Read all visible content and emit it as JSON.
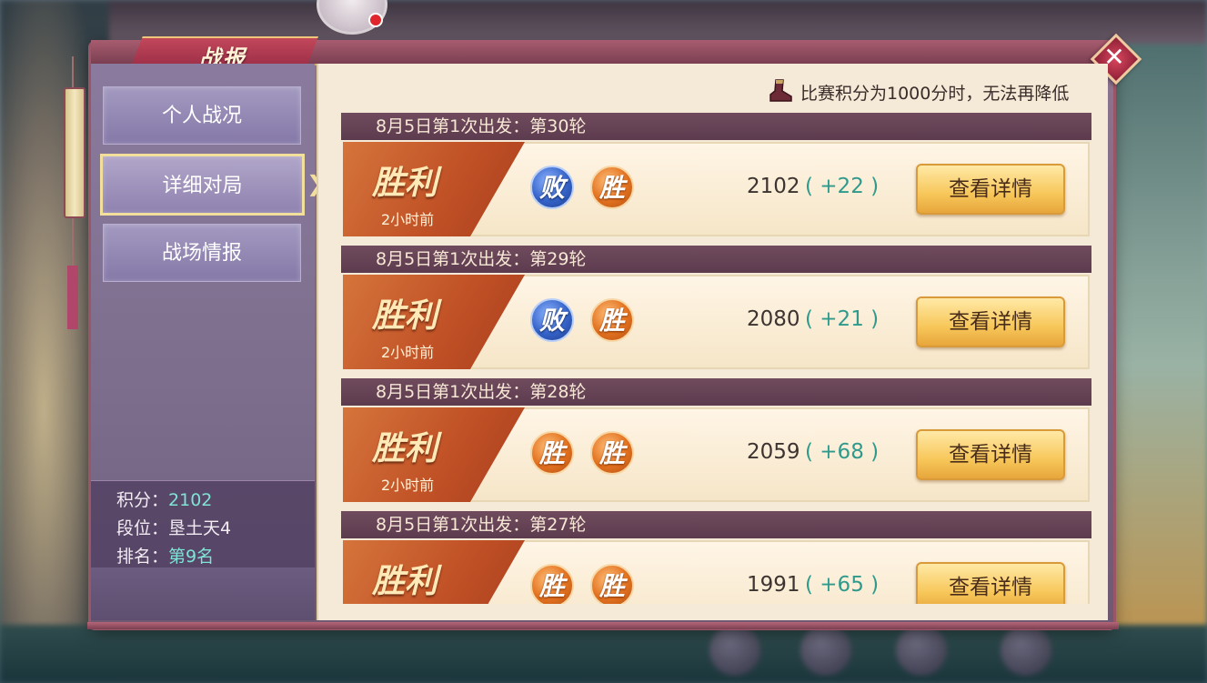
{
  "title": "战报",
  "close_icon": "close-icon",
  "sidebar": {
    "tabs": [
      {
        "label": "个人战况",
        "active": false
      },
      {
        "label": "详细对局",
        "active": true
      },
      {
        "label": "战场情报",
        "active": false
      }
    ],
    "stats": {
      "score_label": "积分：",
      "score_value": "2102",
      "rank_label": "段位：",
      "rank_value": "垦土天4",
      "place_label": "排名：",
      "place_value": "第9名"
    }
  },
  "notice": "比赛积分为1000分时，无法再降低",
  "matches": [
    {
      "header": "8月5日第1次出发：第30轮",
      "result": "胜利",
      "time": "2小时前",
      "medals": [
        {
          "text": "败",
          "type": "lose"
        },
        {
          "text": "胜",
          "type": "win"
        }
      ],
      "score": "2102",
      "delta": "( +22 )",
      "button": "查看详情"
    },
    {
      "header": "8月5日第1次出发：第29轮",
      "result": "胜利",
      "time": "2小时前",
      "medals": [
        {
          "text": "败",
          "type": "lose"
        },
        {
          "text": "胜",
          "type": "win"
        }
      ],
      "score": "2080",
      "delta": "( +21 )",
      "button": "查看详情"
    },
    {
      "header": "8月5日第1次出发：第28轮",
      "result": "胜利",
      "time": "2小时前",
      "medals": [
        {
          "text": "胜",
          "type": "win"
        },
        {
          "text": "胜",
          "type": "win"
        }
      ],
      "score": "2059",
      "delta": "( +68 )",
      "button": "查看详情"
    },
    {
      "header": "8月5日第1次出发：第27轮",
      "result": "胜利",
      "time": "",
      "medals": [
        {
          "text": "胜",
          "type": "win"
        },
        {
          "text": "胜",
          "type": "win"
        }
      ],
      "score": "1991",
      "delta": "( +65 )",
      "button": "查看详情"
    }
  ],
  "colors": {
    "accent": "#7fe3d5",
    "win": "#e2711f",
    "lose": "#3563c9",
    "delta": "#2f9a8c"
  }
}
